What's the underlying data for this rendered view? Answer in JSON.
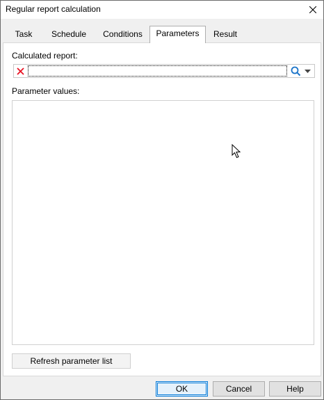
{
  "window": {
    "title": "Regular report calculation"
  },
  "tabs": [
    {
      "label": "Task",
      "active": false
    },
    {
      "label": "Schedule",
      "active": false
    },
    {
      "label": "Conditions",
      "active": false
    },
    {
      "label": "Parameters",
      "active": true
    },
    {
      "label": "Result",
      "active": false
    }
  ],
  "parameters_panel": {
    "calculated_report_label": "Calculated report:",
    "calculated_report_value": "",
    "parameter_values_label": "Parameter values:",
    "refresh_button_label": "Refresh parameter list"
  },
  "footer": {
    "ok_label": "OK",
    "cancel_label": "Cancel",
    "help_label": "Help"
  },
  "icons": {
    "clear": "close-red-icon",
    "search": "search-icon",
    "dropdown": "chevron-down-icon",
    "close": "close-icon",
    "cursor": "mouse-cursor-icon"
  },
  "colors": {
    "clear_icon": "#e81123",
    "search_icon": "#1a73c8",
    "ok_border": "#0078d7"
  }
}
